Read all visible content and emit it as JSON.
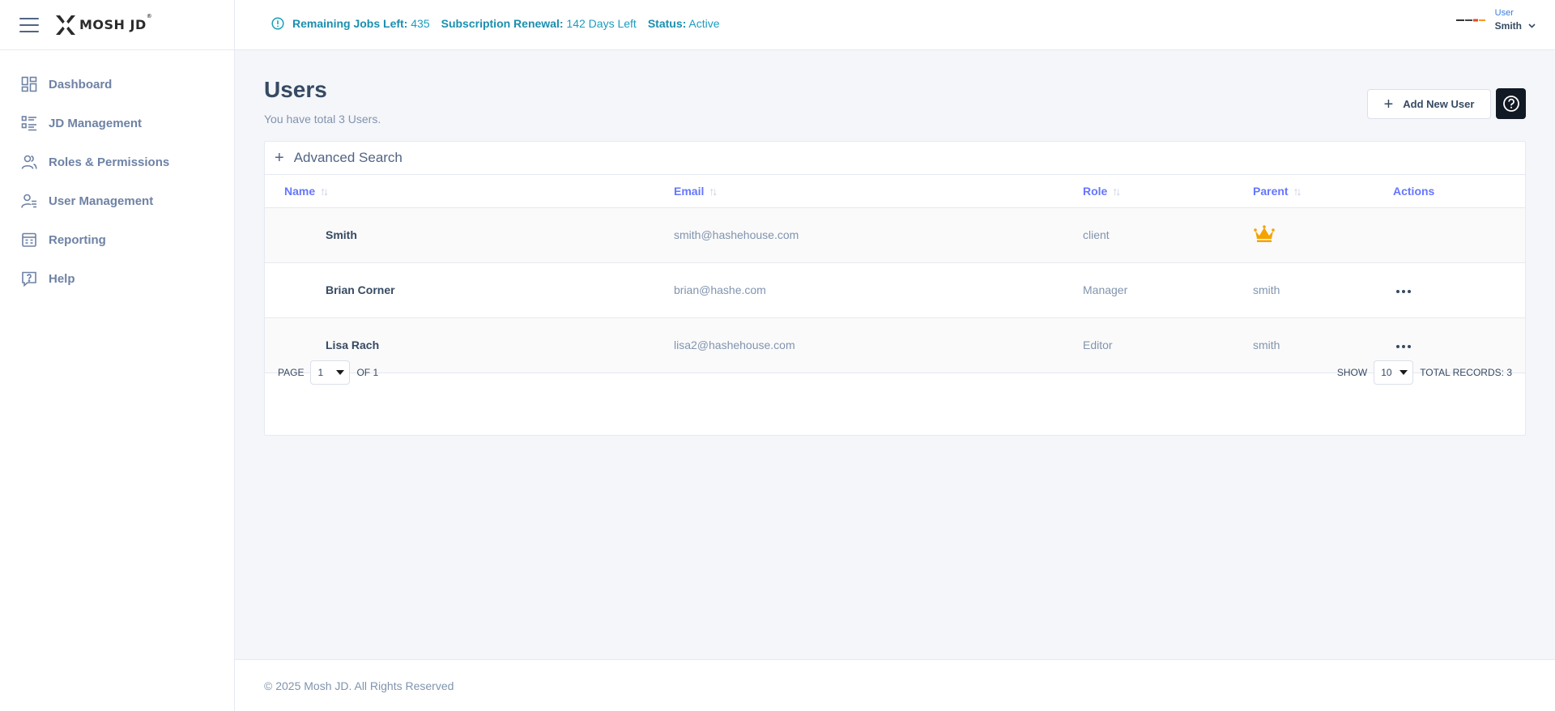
{
  "brand": {
    "name": "MOSH JD",
    "reg": "®"
  },
  "sidebar": {
    "items": [
      {
        "label": "Dashboard",
        "icon": "dashboard-grid-icon"
      },
      {
        "label": "JD Management",
        "icon": "list-icon"
      },
      {
        "label": "Roles & Permissions",
        "icon": "users-icon"
      },
      {
        "label": "User Management",
        "icon": "user-list-icon"
      },
      {
        "label": "Reporting",
        "icon": "report-icon"
      },
      {
        "label": "Help",
        "icon": "help-question-icon"
      }
    ]
  },
  "topbar": {
    "jobs_label": "Remaining Jobs Left:",
    "jobs_value": "435",
    "renewal_label": "Subscription Renewal:",
    "renewal_value": "142 Days Left",
    "status_label": "Status:",
    "status_value": "Active",
    "user_role": "User",
    "user_name": "Smith"
  },
  "page": {
    "title": "Users",
    "subtitle": "You have total 3 Users.",
    "add_button": "Add New User"
  },
  "advanced_search": {
    "label": "Advanced Search"
  },
  "table": {
    "headers": {
      "name": "Name",
      "email": "Email",
      "role": "Role",
      "parent": "Parent",
      "actions": "Actions"
    },
    "rows": [
      {
        "name": "Smith",
        "email": "smith@hashehouse.com",
        "role": "client",
        "parent": "",
        "parent_icon": "crown-icon",
        "has_actions": false
      },
      {
        "name": "Brian Corner",
        "email": "brian@hashe.com",
        "role": "Manager",
        "parent": "smith",
        "has_actions": true
      },
      {
        "name": "Lisa Rach",
        "email": "lisa2@hashehouse.com",
        "role": "Editor",
        "parent": "smith",
        "has_actions": true
      }
    ]
  },
  "pagination": {
    "page_label": "PAGE",
    "page_value": "1",
    "of_label": "OF 1",
    "show_label": "SHOW",
    "show_value": "10",
    "total_label": "TOTAL RECORDS: 3"
  },
  "footer": {
    "text": "© 2025 Mosh JD. All Rights Reserved"
  },
  "colors": {
    "accent": "#6576ff",
    "info": "#17a2b8",
    "crown": "#f4a300",
    "dark_button": "#101924"
  }
}
